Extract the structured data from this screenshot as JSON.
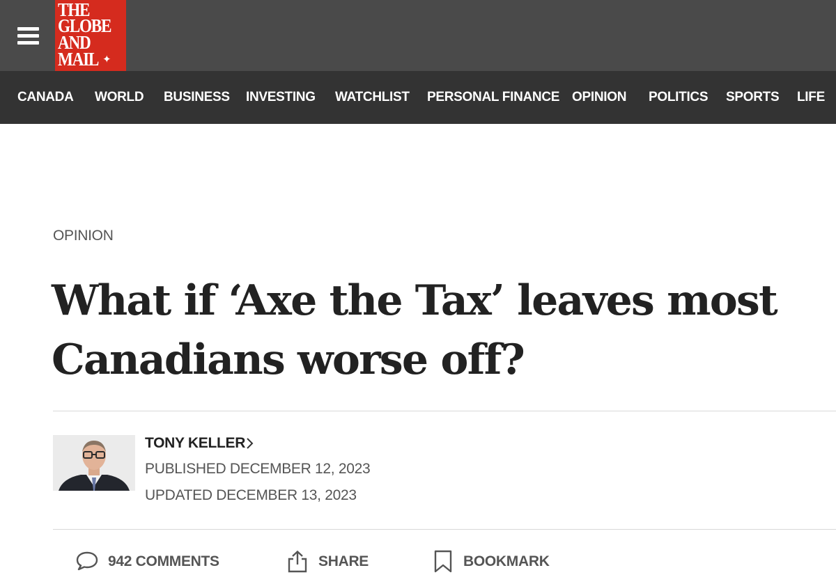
{
  "header": {
    "logo_lines": [
      "THE",
      "GLOBE",
      "AND",
      "MAIL"
    ],
    "logo_color": "#d52b1e",
    "menu_icon": "hamburger-menu-icon"
  },
  "nav": {
    "items": [
      "CANADA",
      "WORLD",
      "BUSINESS",
      "INVESTING",
      "WATCHLIST",
      "PERSONAL FINANCE",
      "OPINION",
      "POLITICS",
      "SPORTS",
      "LIFE"
    ]
  },
  "article": {
    "section": "OPINION",
    "headline_line1": "What if ‘Axe the Tax’ leaves most",
    "headline_line2": "Canadians worse off?",
    "author": "TONY KELLER",
    "published": "PUBLISHED DECEMBER 12, 2023",
    "updated": "UPDATED DECEMBER 13, 2023"
  },
  "actions": {
    "comments": "942 COMMENTS",
    "share": "SHARE",
    "bookmark": "BOOKMARK"
  }
}
